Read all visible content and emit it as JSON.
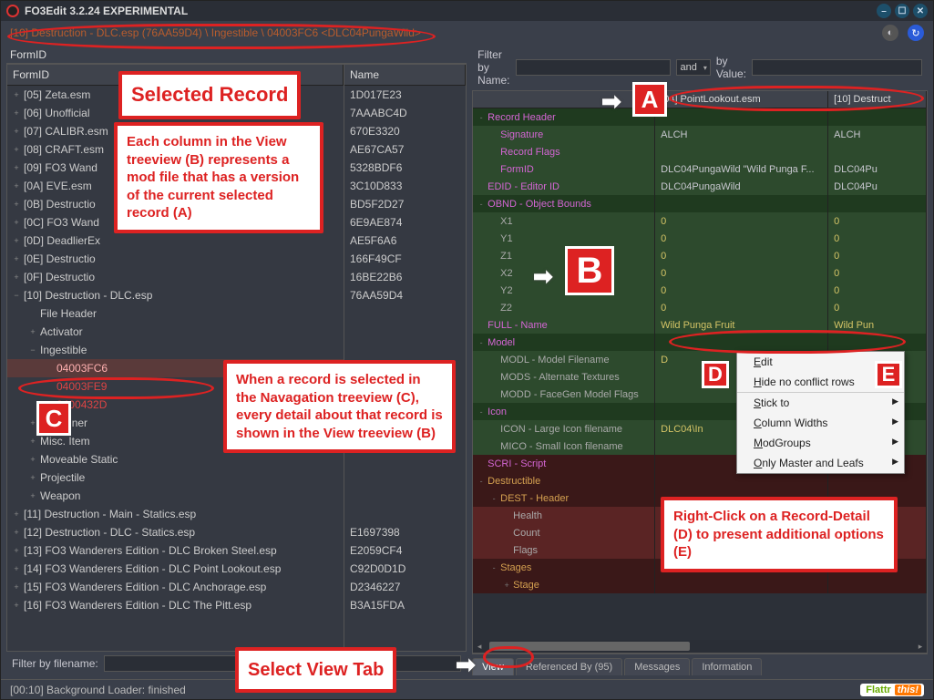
{
  "window": {
    "title": "FO3Edit 3.2.24 EXPERIMENTAL"
  },
  "breadcrumb": "[10] Destruction - DLC.esp (76AA59D4) \\ Ingestible \\ 04003FC6 <DLC04PungaWild>",
  "left_panel": {
    "heading": "FormID",
    "col_formid": "FormID",
    "col_name": "Name",
    "filter_label": "Filter by filename:",
    "filter_value": "",
    "tree": [
      {
        "label": "[05] Zeta.esm",
        "name": "1D017E23",
        "indent": 0,
        "exp": "+"
      },
      {
        "label": "[06] Unofficial",
        "name": "7AAABC4D",
        "indent": 0,
        "exp": "+"
      },
      {
        "label": "[07] CALIBR.esm",
        "name": "670E3320",
        "indent": 0,
        "exp": "+"
      },
      {
        "label": "[08] CRAFT.esm",
        "name": "AE67CA57",
        "indent": 0,
        "exp": "+"
      },
      {
        "label": "[09] FO3 Wand",
        "name": "5328BDF6",
        "indent": 0,
        "exp": "+"
      },
      {
        "label": "[0A] EVE.esm",
        "name": "3C10D833",
        "indent": 0,
        "exp": "+"
      },
      {
        "label": "[0B] Destructio",
        "name": "BD5F2D27",
        "indent": 0,
        "exp": "+"
      },
      {
        "label": "[0C] FO3 Wand",
        "name": "6E9AE874",
        "indent": 0,
        "exp": "+"
      },
      {
        "label": "[0D] DeadlierEx",
        "name": "AE5F6A6",
        "indent": 0,
        "exp": "+"
      },
      {
        "label": "[0E] Destructio",
        "name": "166F49CF",
        "indent": 0,
        "exp": "+"
      },
      {
        "label": "[0F] Destructio",
        "name": "16BE22B6",
        "indent": 0,
        "exp": "+"
      },
      {
        "label": "[10] Destruction - DLC.esp",
        "name": "76AA59D4",
        "indent": 0,
        "exp": "−"
      },
      {
        "label": "File Header",
        "name": "",
        "indent": 1,
        "exp": ""
      },
      {
        "label": "Activator",
        "name": "",
        "indent": 1,
        "exp": "+"
      },
      {
        "label": "Ingestible",
        "name": "",
        "indent": 1,
        "exp": "−"
      },
      {
        "label": "04003FC6",
        "name": "",
        "indent": 2,
        "exp": "",
        "sel": "selbg"
      },
      {
        "label": "04003FE9",
        "name": "",
        "indent": 2,
        "exp": "",
        "sel": "red"
      },
      {
        "label": "0400432D",
        "name": "",
        "indent": 2,
        "exp": "",
        "sel": "red"
      },
      {
        "label": "Container",
        "name": "",
        "indent": 1,
        "exp": "+"
      },
      {
        "label": "Misc. Item",
        "name": "",
        "indent": 1,
        "exp": "+"
      },
      {
        "label": "Moveable Static",
        "name": "",
        "indent": 1,
        "exp": "+"
      },
      {
        "label": "Projectile",
        "name": "",
        "indent": 1,
        "exp": "+"
      },
      {
        "label": "Weapon",
        "name": "",
        "indent": 1,
        "exp": "+"
      },
      {
        "label": "[11] Destruction - Main - Statics.esp",
        "name": "",
        "indent": 0,
        "exp": "+"
      },
      {
        "label": "[12] Destruction - DLC - Statics.esp",
        "name": "E1697398",
        "indent": 0,
        "exp": "+"
      },
      {
        "label": "[13] FO3 Wanderers Edition - DLC Broken Steel.esp",
        "name": "E2059CF4",
        "indent": 0,
        "exp": "+"
      },
      {
        "label": "[14] FO3 Wanderers Edition - DLC Point Lookout.esp",
        "name": "C92D0D1D",
        "indent": 0,
        "exp": "+"
      },
      {
        "label": "[15] FO3 Wanderers Edition - DLC Anchorage.esp",
        "name": "D2346227",
        "indent": 0,
        "exp": "+"
      },
      {
        "label": "[16] FO3 Wanderers Edition - DLC The Pitt.esp",
        "name": "B3A15FDA",
        "indent": 0,
        "exp": "+"
      }
    ]
  },
  "right_panel": {
    "filter_name_label": "Filter by Name:",
    "filter_name_value": "",
    "and_label": "and",
    "by_value_label": "by Value:",
    "by_value_value": "",
    "col_blank": "",
    "col_b": "[04] PointLookout.esm",
    "col_c": "[10] Destruct",
    "rows": [
      {
        "a": "Record Header",
        "b": "",
        "c": "",
        "bg": "dgreen",
        "ac": "txt-mag",
        "exp": "-"
      },
      {
        "a": "Signature",
        "b": "ALCH",
        "c": "ALCH",
        "bg": "green",
        "ac": "txt-mag",
        "indent": 1
      },
      {
        "a": "Record Flags",
        "b": "",
        "c": "",
        "bg": "green",
        "ac": "txt-mag",
        "indent": 1
      },
      {
        "a": "FormID",
        "b": "DLC04PungaWild \"Wild Punga F...",
        "c": "DLC04Pu",
        "bg": "green",
        "ac": "txt-mag",
        "indent": 1
      },
      {
        "a": "EDID - Editor ID",
        "b": "DLC04PungaWild",
        "c": "DLC04Pu",
        "bg": "green",
        "ac": "txt-mag"
      },
      {
        "a": "OBND - Object Bounds",
        "b": "",
        "c": "",
        "bg": "dgreen",
        "ac": "txt-mag",
        "exp": "-"
      },
      {
        "a": "X1",
        "b": "0",
        "c": "0",
        "bg": "green",
        "ac": "txt-gray",
        "bc": "txt-yel",
        "indent": 1
      },
      {
        "a": "Y1",
        "b": "0",
        "c": "0",
        "bg": "green",
        "ac": "txt-gray",
        "bc": "txt-yel",
        "indent": 1
      },
      {
        "a": "Z1",
        "b": "0",
        "c": "0",
        "bg": "green",
        "ac": "txt-gray",
        "bc": "txt-yel",
        "indent": 1
      },
      {
        "a": "X2",
        "b": "0",
        "c": "0",
        "bg": "green",
        "ac": "txt-gray",
        "bc": "txt-yel",
        "indent": 1
      },
      {
        "a": "Y2",
        "b": "0",
        "c": "0",
        "bg": "green",
        "ac": "txt-gray",
        "bc": "txt-yel",
        "indent": 1
      },
      {
        "a": "Z2",
        "b": "0",
        "c": "0",
        "bg": "green",
        "ac": "txt-gray",
        "bc": "txt-yel",
        "indent": 1
      },
      {
        "a": "FULL - Name",
        "b": "Wild Punga Fruit",
        "c": "Wild Pun",
        "bg": "green",
        "ac": "txt-mag",
        "bc": "txt-yel"
      },
      {
        "a": "Model",
        "b": "",
        "c": "",
        "bg": "dgreen",
        "ac": "txt-mag",
        "exp": "-"
      },
      {
        "a": "MODL - Model Filename",
        "b": "D",
        "c": "",
        "bg": "green",
        "ac": "txt-gray",
        "bc": "txt-yel",
        "indent": 1
      },
      {
        "a": "MODS - Alternate Textures",
        "b": "",
        "c": "",
        "bg": "green",
        "ac": "txt-gray",
        "indent": 1
      },
      {
        "a": "MODD - FaceGen Model Flags",
        "b": "",
        "c": "",
        "bg": "green",
        "ac": "txt-gray",
        "indent": 1
      },
      {
        "a": "Icon",
        "b": "",
        "c": "",
        "bg": "dgreen",
        "ac": "txt-mag",
        "exp": "-"
      },
      {
        "a": "ICON - Large Icon filename",
        "b": "DLC04\\In",
        "c": "",
        "bg": "green",
        "ac": "txt-gray",
        "bc": "txt-yel",
        "indent": 1
      },
      {
        "a": "MICO - Small Icon filename",
        "b": "",
        "c": "",
        "bg": "green",
        "ac": "txt-gray",
        "indent": 1
      },
      {
        "a": "SCRI - Script",
        "b": "",
        "c": "",
        "bg": "dred",
        "ac": "txt-mag"
      },
      {
        "a": "Destructible",
        "b": "",
        "c": "",
        "bg": "dred",
        "ac": "txt-orange",
        "exp": "-"
      },
      {
        "a": "DEST - Header",
        "b": "",
        "c": "",
        "bg": "dred",
        "ac": "txt-orange",
        "exp": "-",
        "indent": 1
      },
      {
        "a": "Health",
        "b": "",
        "c": "",
        "bg": "red",
        "ac": "txt-gray",
        "indent": 2
      },
      {
        "a": "Count",
        "b": "",
        "c": "",
        "bg": "red",
        "ac": "txt-gray",
        "indent": 2
      },
      {
        "a": "Flags",
        "b": "",
        "c": "",
        "bg": "red",
        "ac": "txt-gray",
        "indent": 2
      },
      {
        "a": "Stages",
        "b": "",
        "c": "",
        "bg": "dred",
        "ac": "txt-orange",
        "exp": "-",
        "indent": 1
      },
      {
        "a": "Stage",
        "b": "",
        "c": "",
        "bg": "dred",
        "ac": "txt-orange",
        "exp": "+",
        "indent": 2
      }
    ],
    "tabs": [
      "View",
      "Referenced By (95)",
      "Messages",
      "Information"
    ],
    "active_tab": 0
  },
  "context_menu": {
    "items": [
      {
        "label": "Edit",
        "u": 0
      },
      {
        "label": "Hide no conflict rows",
        "u": 0,
        "sep": true
      },
      {
        "label": "Stick to",
        "u": 0,
        "sub": true
      },
      {
        "label": "Column Widths",
        "u": 0,
        "sub": true
      },
      {
        "label": "ModGroups",
        "u": 0,
        "sub": true
      },
      {
        "label": "Only Master and Leafs",
        "u": 0,
        "sub": true
      }
    ]
  },
  "status_text": "[00:10] Background Loader: finished",
  "flattr": {
    "a": "Flattr",
    "b": "this!"
  },
  "annotations": {
    "selected_record": "Selected Record",
    "select_view_tab": "Select View Tab",
    "box1": "Each column in the View treeview (B) represents a mod file that has a version of the current selected record (A)",
    "box2": "When a record is selected in the Navagation treeview (C), every detail about that record is shown in the View treeview (B)",
    "box3": "Right-Click on a Record-Detail (D) to present additional options (E)",
    "A": "A",
    "B": "B",
    "C": "C",
    "D": "D",
    "E": "E"
  }
}
